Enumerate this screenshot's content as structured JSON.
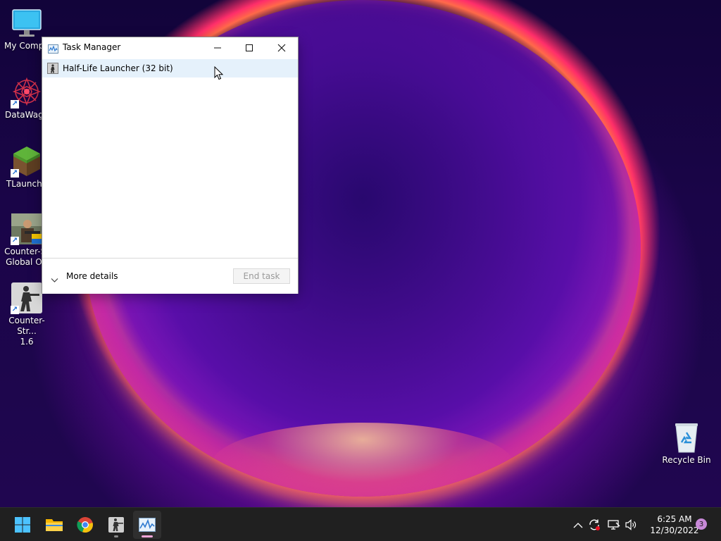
{
  "desktop": {
    "icons": [
      {
        "label": "My Compu",
        "icon": "monitor-icon"
      },
      {
        "label": "DataWago",
        "icon": "datawagon-icon"
      },
      {
        "label": "TLaunche",
        "icon": "minecraft-grass-block-icon"
      },
      {
        "label_line1": "Counter-St",
        "label_line2": "Global Off",
        "icon": "csgo-icon"
      },
      {
        "label_line1": "Counter-Str...",
        "label_line2": "1.6",
        "icon": "counter-strike-icon"
      }
    ],
    "recycle_bin": {
      "label": "Recycle Bin",
      "icon": "recycle-bin-icon"
    }
  },
  "task_manager": {
    "title": "Task Manager",
    "minimize_label": "—",
    "maximize_label": "☐",
    "close_label": "✕",
    "process": {
      "name": "Half-Life Launcher (32 bit)",
      "icon": "half-life-icon"
    },
    "footer": {
      "more_details": "More details",
      "end_task": "End task"
    }
  },
  "taskbar": {
    "apps": [
      {
        "name": "start",
        "icon": "windows-logo-icon"
      },
      {
        "name": "file-explorer",
        "icon": "folder-icon"
      },
      {
        "name": "chrome",
        "icon": "chrome-icon"
      },
      {
        "name": "counter-strike",
        "icon": "counter-strike-icon"
      },
      {
        "name": "task-manager",
        "icon": "task-manager-icon"
      }
    ],
    "tray": {
      "chevron": "^",
      "time": "6:25 AM",
      "date": "12/30/2022",
      "notification_count": "3"
    }
  },
  "colors": {
    "selection": "#e5f1fb",
    "taskbar": "#202020",
    "accent_indicator": "#f3a6d8"
  }
}
